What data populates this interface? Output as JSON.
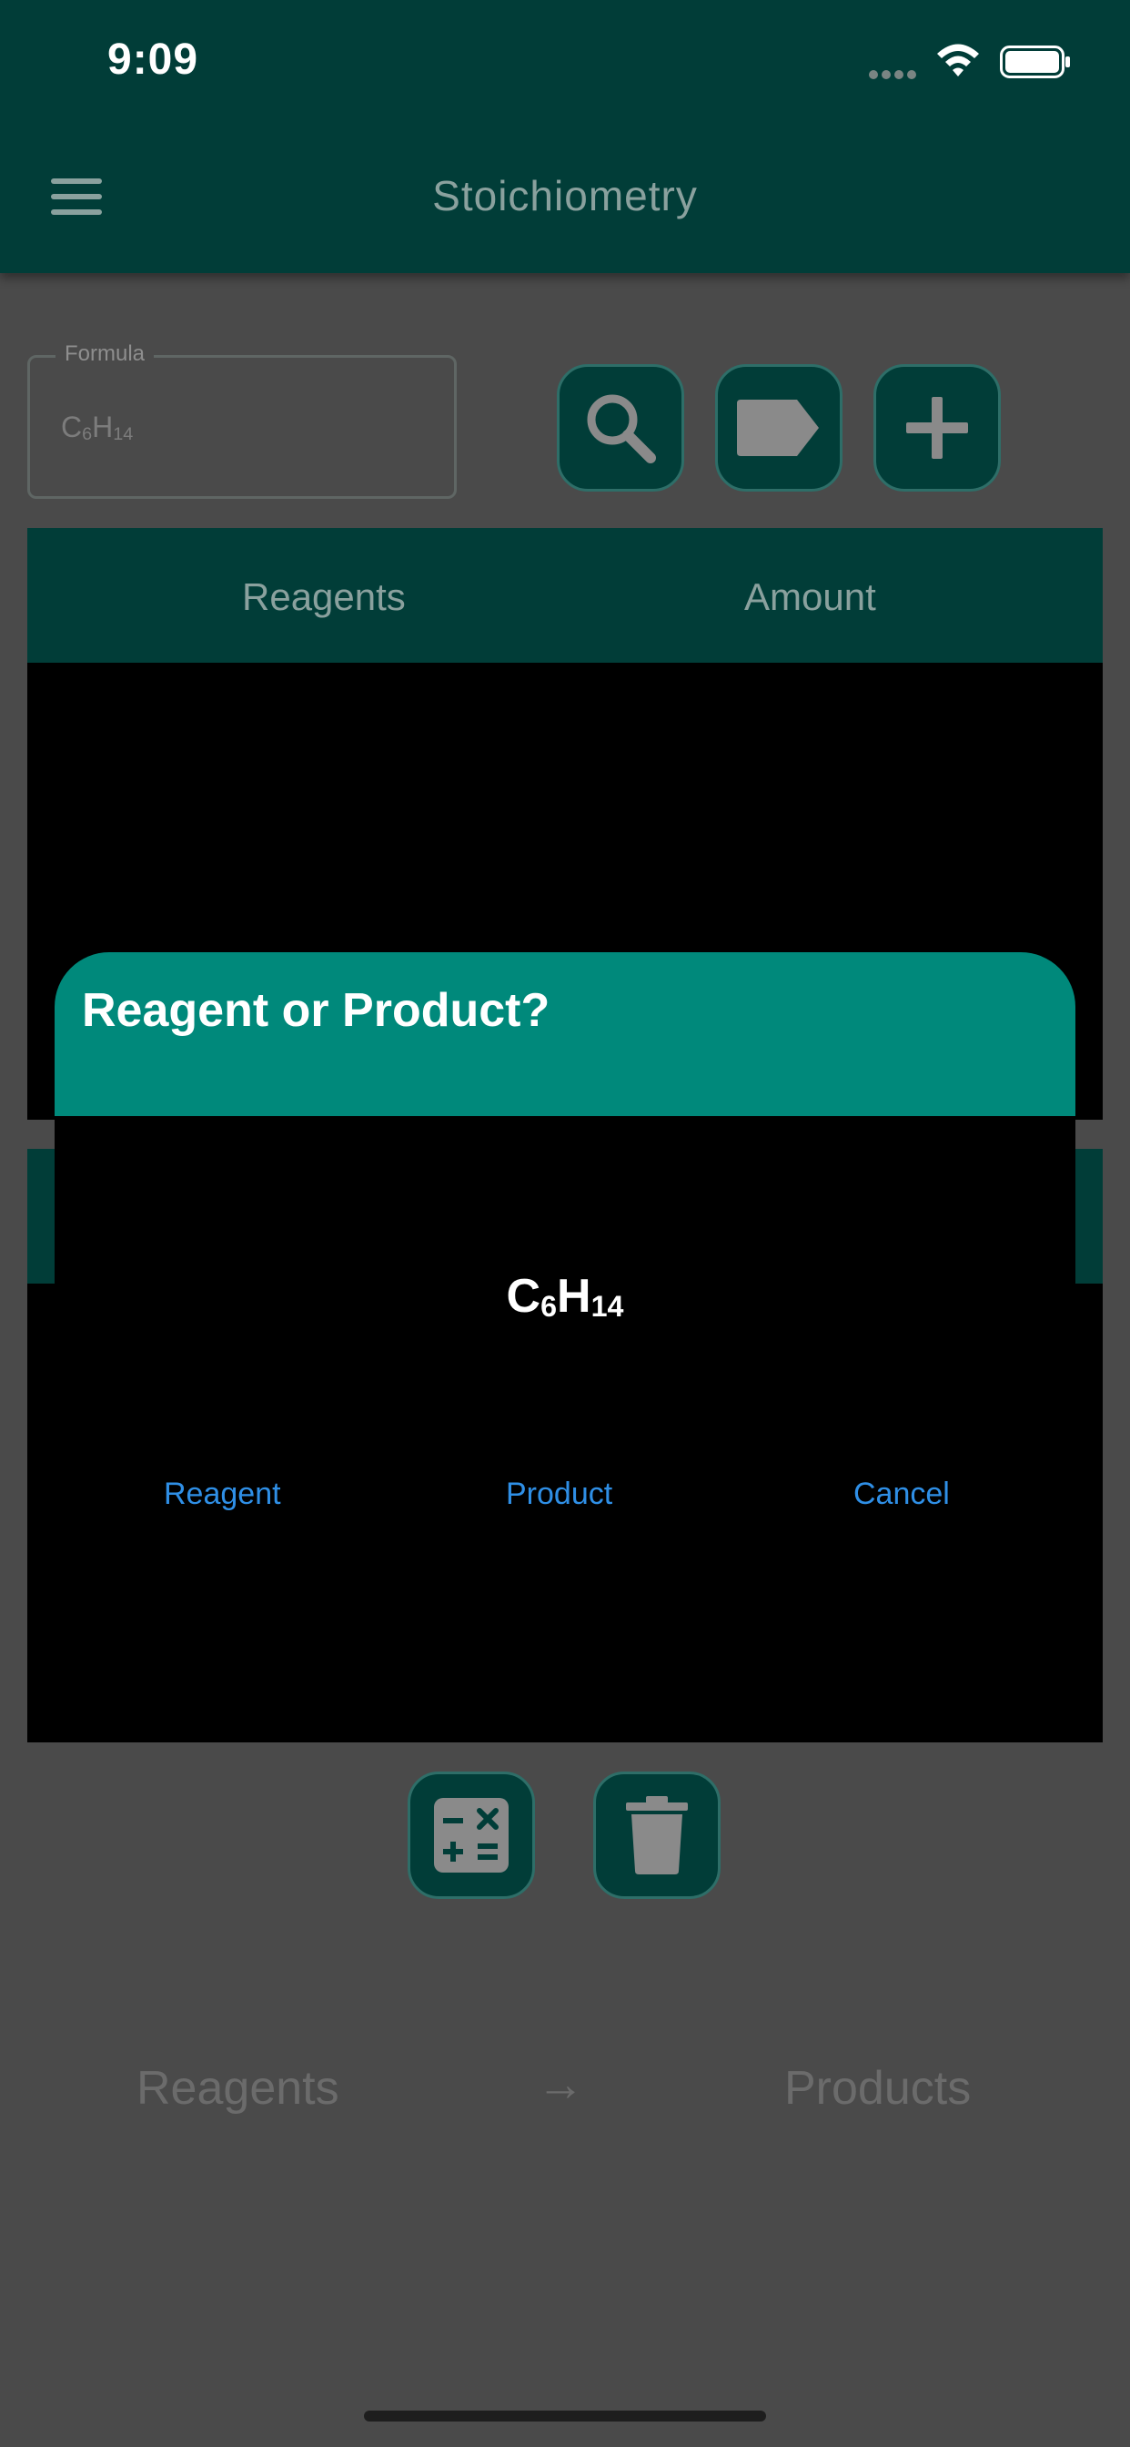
{
  "status_bar": {
    "time": "9:09"
  },
  "app_bar": {
    "title": "Stoichiometry"
  },
  "formula_field": {
    "label": "Formula",
    "value_parts": [
      {
        "text": "C",
        "sub": false
      },
      {
        "text": "6",
        "sub": true
      },
      {
        "text": "H",
        "sub": false
      },
      {
        "text": "14",
        "sub": true
      }
    ]
  },
  "toolbar": {
    "search_icon": "magnifier-icon",
    "label_icon": "tag-icon",
    "add_icon": "plus-icon"
  },
  "reagents_table": {
    "columns": [
      "Reagents",
      "Amount"
    ]
  },
  "bottom_actions": {
    "calculate_icon": "calculator-icon",
    "delete_icon": "trash-icon"
  },
  "equation": {
    "reagents": "Reagents",
    "arrow": "→",
    "products": "Products"
  },
  "dialog": {
    "title": "Reagent or Product?",
    "formula_parts": [
      {
        "text": "C",
        "sub": false
      },
      {
        "text": "6",
        "sub": true
      },
      {
        "text": "H",
        "sub": false
      },
      {
        "text": "14",
        "sub": true
      }
    ],
    "buttons": {
      "reagent": "Reagent",
      "product": "Product",
      "cancel": "Cancel"
    }
  },
  "colors": {
    "app_bar": "#013d38",
    "dialog_header": "#00897b",
    "dialog_button_text": "#2f8fe6",
    "overlay": "#4a4a4a"
  }
}
